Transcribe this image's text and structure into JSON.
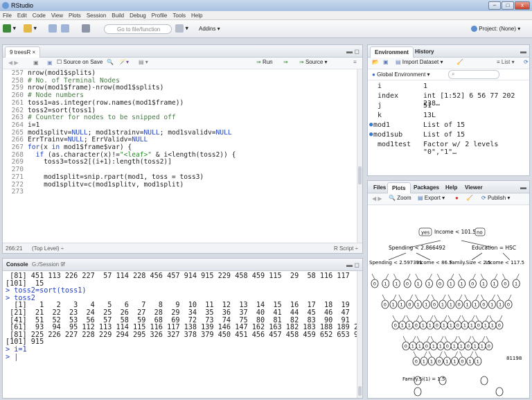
{
  "window": {
    "title": "RStudio",
    "min": "–",
    "max": "□",
    "close": "x"
  },
  "menu": [
    "File",
    "Edit",
    "Code",
    "View",
    "Plots",
    "Session",
    "Build",
    "Debug",
    "Profile",
    "Tools",
    "Help"
  ],
  "toolbar": {
    "goto_placeholder": "Go to file/function",
    "addins": "Addins ▾",
    "project": "Project: (None) ▾"
  },
  "editor": {
    "tab": "9 treesR ×",
    "source_on_save": "Source on Save",
    "run": "Run",
    "source": "Source ▾",
    "lines": [
      {
        "n": "257",
        "t": "nrow(mod1$splits)"
      },
      {
        "n": "258",
        "t": "# No. of Terminal Nodes"
      },
      {
        "n": "259",
        "t": "nrow(mod1$frame)-nrow(mod1$splits)"
      },
      {
        "n": "260",
        "t": "# Node numbers"
      },
      {
        "n": "261",
        "t": "toss1=as.integer(row.names(mod1$frame))"
      },
      {
        "n": "262",
        "t": "toss2=sort(toss1)"
      },
      {
        "n": "263",
        "t": "# Counter for nodes to be snipped off"
      },
      {
        "n": "264",
        "t": "i=1"
      },
      {
        "n": "265",
        "t": "mod1splitv=NULL; mod1strainv=NULL; mod1svalidv=NULL"
      },
      {
        "n": "266",
        "t": "ErrTrainv=NULL; ErrValidv=NULL"
      },
      {
        "n": "267",
        "t": "for(x in mod1$frame$var) {"
      },
      {
        "n": "268",
        "t": "  if (as.character(x)!=\"<leaf>\" & i<length(toss2)) {"
      },
      {
        "n": "269",
        "t": "    toss3=toss2[(i+1):length(toss2)]"
      },
      {
        "n": "270",
        "t": ""
      },
      {
        "n": "271",
        "t": "    mod1split=snip.rpart(mod1, toss = toss3)"
      },
      {
        "n": "272",
        "t": "    mod1splitv=c(mod1splitv, mod1split)"
      },
      {
        "n": "273",
        "t": ""
      }
    ],
    "status_pos": "266:21",
    "status_scope": "(Top Level) ÷",
    "status_type": "R Script ÷"
  },
  "console": {
    "title": "Console",
    "path": "G:/Session 9/",
    "lines": [
      " [81] 451 113 226 227  57 114 228 456 457 914 915 229 458 459 115  29  58 116 117  59",
      "[101]  15",
      "> toss2=sort(toss1)",
      "> toss2",
      "  [1]   1   2   3   4   5   6   7   8   9  10  11  12  13  14  15  16  17  18  19  20",
      " [21]  21  22  23  24  25  26  27  28  29  34  35  36  37  40  41  44  45  46  47  50",
      " [41]  51  52  53  56  57  58  59  68  69  72  73  74  75  80  81  82  83  90  91  92",
      " [61]  93  94  95 112 113 114 115 116 117 138 139 146 147 162 163 182 183 188 189 224",
      " [81] 225 226 227 228 229 294 295 326 327 378 379 450 451 456 457 458 459 652 653 914",
      "[101] 915",
      "> i=1",
      "> |"
    ]
  },
  "environment": {
    "tabs": [
      "Environment",
      "History"
    ],
    "import": "Import Dataset ▾",
    "list": "List ▾",
    "scope": "Global Environment ▾",
    "rows": [
      {
        "name": "i",
        "value": "1"
      },
      {
        "name": "index",
        "value": "int [1:52] 6 56 77 202 238…"
      },
      {
        "name": "j",
        "value": "51"
      },
      {
        "name": "k",
        "value": "13L"
      },
      {
        "name": "mod1",
        "value": "List of 15"
      },
      {
        "name": "mod1sub",
        "value": "List of 15"
      },
      {
        "name": "mod1test",
        "value": "Factor w/ 2 levels \"0\",\"1\"…"
      }
    ]
  },
  "files": {
    "tabs": [
      "Files",
      "Plots",
      "Packages",
      "Help",
      "Viewer"
    ],
    "zoom": "Zoom",
    "export": "Export ▾",
    "publish": "Publish ▾",
    "tree_labels": {
      "root": "Income < 101.5",
      "yes": "yes",
      "no": "no",
      "l": "Spending < 2.866492",
      "r": "Education = HSC",
      "ll": "Spending < 2.597391",
      "lr": "Income < 86.5",
      "rl": "Family.Size < 2.5",
      "rr": "Income < 117.5",
      "leaf_a": "Family.Si(1) = 1.5",
      "leaf_b": "81198"
    }
  }
}
